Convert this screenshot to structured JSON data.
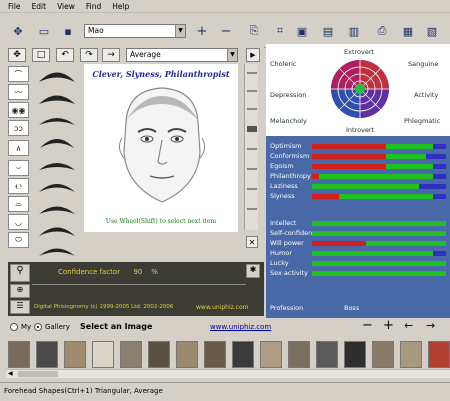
{
  "menu": [
    "File",
    "Edit",
    "View",
    "Find",
    "Help"
  ],
  "toolbar": {
    "name_value": "Mao"
  },
  "composer": {
    "variant_value": "Average",
    "portrait_title": "Clever, Slyness, Philanthropist",
    "hint": "Use Wheel(Shift) to select next item"
  },
  "confidence": {
    "label": "Confidence factor",
    "value": "90",
    "unit": "%",
    "footer": "Digital Phisiognomy (c) 1999-2005 Ltd. 2002-2006",
    "link": "www.uniphiz.com"
  },
  "temperament": {
    "extrovert": "Extrovert",
    "introvert": "Introvert",
    "choleric": "Choleric",
    "sanguine": "Sanguine",
    "depression": "Depression",
    "activity": "Activity",
    "melancholy": "Melancholy",
    "phlegmatic": "Phlegmatic"
  },
  "traits": [
    {
      "label": "Optimism",
      "red": 0.55,
      "green": 0.35,
      "blue": 0.1
    },
    {
      "label": "Conformism",
      "red": 0.55,
      "green": 0.3,
      "blue": 0.15
    },
    {
      "label": "Egoism",
      "red": 0.55,
      "green": 0.35,
      "blue": 0.1
    },
    {
      "label": "Philanthropy",
      "red": 0.05,
      "green": 0.85,
      "blue": 0.1
    },
    {
      "label": "Laziness",
      "red": 0.0,
      "green": 0.8,
      "blue": 0.2
    },
    {
      "label": "Slyness",
      "red": 0.2,
      "green": 0.7,
      "blue": 0.1
    }
  ],
  "abilities": [
    {
      "label": "Intellect",
      "red": 0.0,
      "green": 1.0,
      "blue": 0.0
    },
    {
      "label": "Self-confidence",
      "red": 0.0,
      "green": 1.0,
      "blue": 0.0
    },
    {
      "label": "Will power",
      "red": 0.4,
      "green": 0.6,
      "blue": 0.0
    },
    {
      "label": "Humor",
      "red": 0.0,
      "green": 0.9,
      "blue": 0.1
    },
    {
      "label": "Lucky",
      "red": 0.0,
      "green": 1.0,
      "blue": 0.0
    },
    {
      "label": "Sex activity",
      "red": 0.0,
      "green": 1.0,
      "blue": 0.0
    }
  ],
  "profession": {
    "label": "Profession",
    "value": "Boss"
  },
  "gallery": {
    "my_label": "My",
    "gallery_label": "Gallery",
    "select_label": "Select an Image",
    "link": "www.uniphiz.com"
  },
  "status": {
    "text": "Forehead Shapes(Ctrl+1) Triangular, Average"
  }
}
